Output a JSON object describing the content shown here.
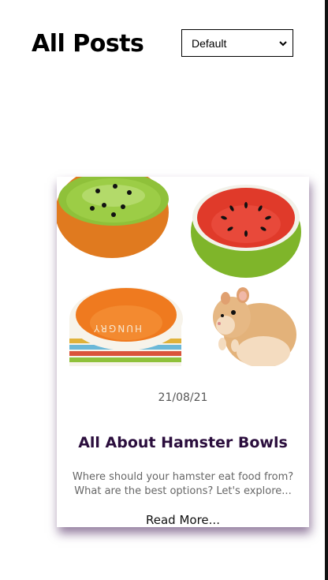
{
  "page": {
    "title": "All Posts"
  },
  "sort": {
    "selected": "Default",
    "options": [
      "Default"
    ]
  },
  "posts": [
    {
      "date": "21/08/21",
      "title": "All About Hamster Bowls",
      "excerpt": "Where should your hamster eat food from? What are the best options? Let's explore...",
      "read_more": "Read More...",
      "image_alt": "hamster bowls and a hamster"
    }
  ],
  "colors": {
    "title_text": "#2b0e3d",
    "card_shadow": "#3c1450"
  }
}
